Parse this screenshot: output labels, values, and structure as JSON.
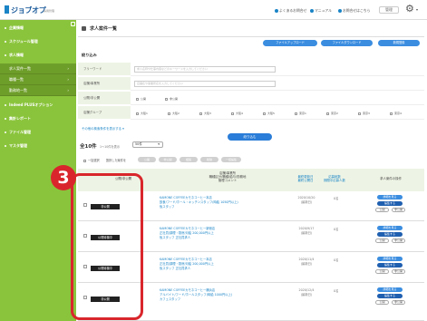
{
  "header": {
    "logo_text": "ジョブオプ",
    "logo_sub": "採用管理",
    "links": [
      "よくあるお問合せ",
      "マニュアル",
      "お問合せはこちら"
    ],
    "user": "管理"
  },
  "sidebar": {
    "items": [
      {
        "label": "企業情報"
      },
      {
        "label": "スケジュール管理"
      },
      {
        "label": "求人情報"
      }
    ],
    "subitems": [
      {
        "label": "求人案件一覧"
      },
      {
        "label": "職種一覧"
      },
      {
        "label": "勤務地一覧"
      }
    ],
    "items2": [
      {
        "label": "Indeed PLUSオプション"
      },
      {
        "label": "集計レポート"
      },
      {
        "label": "ファイル管理"
      },
      {
        "label": "マスタ管理"
      }
    ]
  },
  "page": {
    "title": "求人案件一覧",
    "buttons": [
      "ファイルアップロード",
      "ファイルダウンロード",
      "新規登録"
    ]
  },
  "search": {
    "heading": "絞り込み",
    "fields": [
      {
        "label": "フリーワード",
        "placeholder": "求人名称や仕事内容などのキーワードを入力してください"
      },
      {
        "label": "店舗/事業所",
        "placeholder": "店舗名や事業所名を入力してください"
      },
      {
        "label": "公開/非公開"
      },
      {
        "label": "店舗グループ"
      }
    ],
    "publish_options": [
      "公開",
      "非公開"
    ],
    "group_options": [
      "大阪1",
      "大阪2",
      "大阪3",
      "大阪4",
      "大阪5",
      "東京1",
      "東京2",
      "東京3",
      "東京4"
    ],
    "more_link": "その他の検索条件を表示する",
    "submit": "絞り込む"
  },
  "results": {
    "count": "全10件",
    "count_sub": "1〜10件を表示",
    "per_page": "50件",
    "bulk_label": "一括選択",
    "bulk_action": "選択した案件を",
    "bulk_buttons": [
      "公開",
      "非公開",
      "複製",
      "削除",
      "一括編集"
    ]
  },
  "table": {
    "headers": [
      "公開/非公開",
      "店舗/事業所\n職種区分/職種/給与/勤務地\n管理コメント",
      "最終更新日\n最終公開日",
      "応募総数\n期間中応募人数",
      "求人案件の操作"
    ],
    "rows": [
      {
        "status": "非公開",
        "lines": [
          "KAMONE COFFEEカモネコーヒー本店",
          "飲食/フード/ホール・キッチンスタッフ(時給 1050円以上)",
          "仮スタッフ"
        ],
        "dates": [
          "2020/10/20",
          "(最新日)"
        ],
        "count": "0名"
      },
      {
        "status": "公開待機中",
        "lines": [
          "KAMONE COFFEEカモネコーヒー新宿店",
          "正社員/調理・厨房/月給 200,000円以上",
          "仮スタッフ 正社員求人"
        ],
        "dates": [
          "2020/9/17",
          "(最新日)"
        ],
        "count": "0名"
      },
      {
        "status": "公開待機中",
        "lines": [
          "KAMONE COFFEEカモネコーヒー本店",
          "正社員/調理・厨房/月給 200,000円以上",
          "仮スタッフ 正社員求人"
        ],
        "dates": [
          "2020/11/4",
          "(最新日)"
        ],
        "count": "0名"
      },
      {
        "status": "非公開",
        "lines": [
          "KAMONE COFFEEカモネコーヒー横浜店",
          "アルバイト/フード/ホールスタッフ(時給 1000円以上)",
          "カフェスタッフ"
        ],
        "dates": [
          "2020/12/4",
          "(最新日)"
        ],
        "count": "0名"
      }
    ],
    "row_buttons": [
      "詳細を見る",
      "編集する",
      "公開",
      "非公開"
    ]
  },
  "callout": {
    "number": "3"
  }
}
